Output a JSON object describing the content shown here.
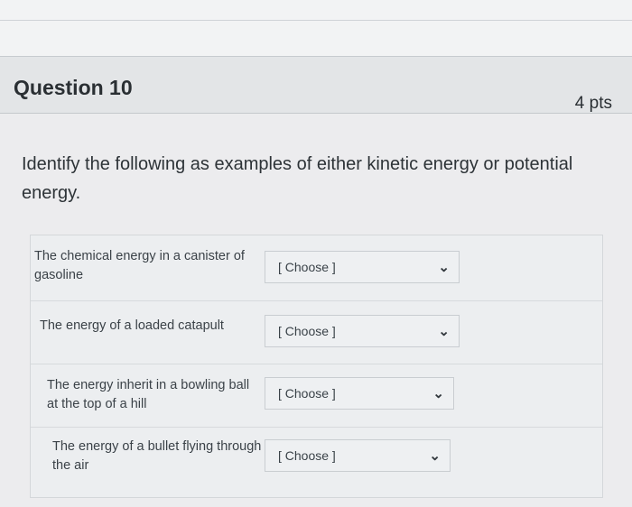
{
  "question": {
    "title": "Question 10",
    "points": "4 pts",
    "prompt": "Identify the following as examples of either kinetic energy or potential energy."
  },
  "items": [
    {
      "label": "The chemical energy in a canister of gasoline",
      "selected": "[ Choose ]"
    },
    {
      "label": "The energy of a loaded catapult",
      "selected": "[ Choose ]"
    },
    {
      "label": "The energy inherit in a bowling ball at the top of a hill",
      "selected": "[ Choose ]"
    },
    {
      "label": "The energy of a bullet flying through the air",
      "selected": "[ Choose ]"
    }
  ],
  "icons": {
    "dropdown": "chevron-down-icon"
  }
}
